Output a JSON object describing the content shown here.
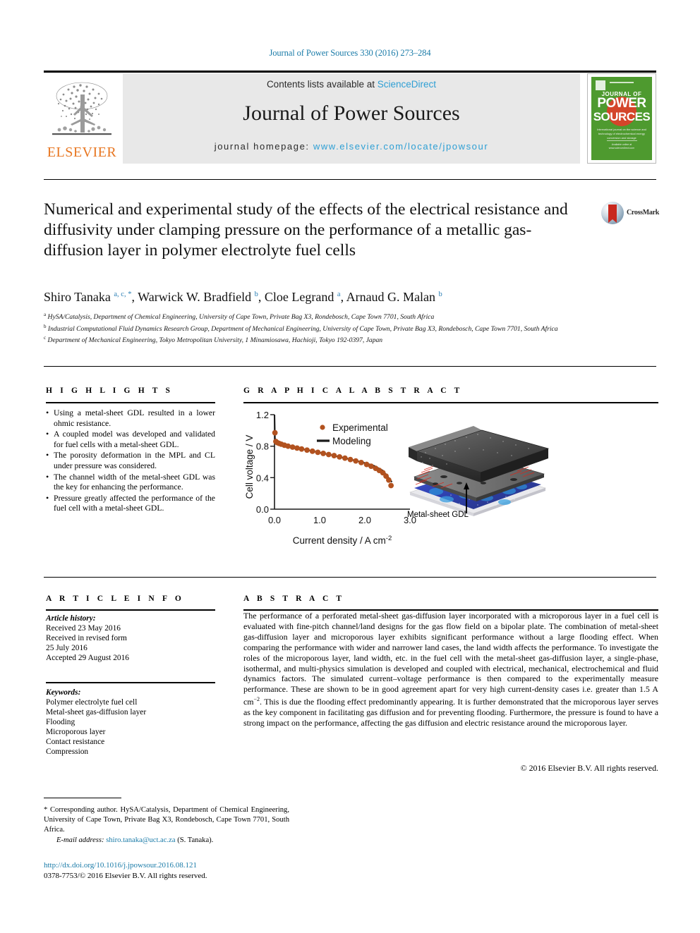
{
  "header": {
    "citation": "Journal of Power Sources 330 (2016) 273–284",
    "contents_prefix": "Contents lists available at ",
    "contents_link": "ScienceDirect",
    "journal_name": "Journal of Power Sources",
    "homepage_prefix": "journal homepage: ",
    "homepage_link": "www.elsevier.com/locate/jpowsour",
    "publisher": "ELSEVIER",
    "cover": {
      "line1": "JOURNAL OF",
      "line2": "POWER",
      "line3": "SOURCES",
      "subtitle": "International journal on the science and technology of electrochemical energy conversion and storage",
      "footer": "Available online at www.sciencedirect.com"
    }
  },
  "article": {
    "title": "Numerical and experimental study of the effects of the electrical resistance and diffusivity under clamping pressure on the performance of a metallic gas-diffusion layer in polymer electrolyte fuel cells",
    "crossmark_label": "CrossMark",
    "authors": [
      {
        "name": "Shiro Tanaka",
        "marks": "a, c, *"
      },
      {
        "name": "Warwick W. Bradfield",
        "marks": "b"
      },
      {
        "name": "Cloe Legrand",
        "marks": "a"
      },
      {
        "name": "Arnaud G. Malan",
        "marks": "b"
      }
    ],
    "affiliations": [
      {
        "mark": "a",
        "text": "HySA/Catalysis, Department of Chemical Engineering, University of Cape Town, Private Bag X3, Rondebosch, Cape Town 7701, South Africa"
      },
      {
        "mark": "b",
        "text": "Industrial Computational Fluid Dynamics Research Group, Department of Mechanical Engineering, University of Cape Town, Private Bag X3, Rondebosch, Cape Town 7701, South Africa"
      },
      {
        "mark": "c",
        "text": "Department of Mechanical Engineering, Tokyo Metropolitan University, 1 Minamiosawa, Hachioji, Tokyo 192-0397, Japan"
      }
    ]
  },
  "highlights": {
    "heading": "H I G H L I G H T S",
    "items": [
      "Using a metal-sheet GDL resulted in a lower ohmic resistance.",
      "A coupled model was developed and validated for fuel cells with a metal-sheet GDL.",
      "The porosity deformation in the MPL and CL under pressure was considered.",
      "The channel width of the metal-sheet GDL was the key for enhancing the performance.",
      "Pressure greatly affected the performance of the fuel cell with a metal-sheet GDL."
    ]
  },
  "graphical_abstract": {
    "heading": "G R A P H I C A L   A B S T R A C T",
    "figure_caption": "Metal-sheet GDL"
  },
  "chart_data": {
    "type": "scatter",
    "title": "",
    "xlabel": "Current density / A cm-2",
    "xlabel_base": "Current density / A cm",
    "xlabel_exp": "-2",
    "ylabel": "Cell voltage / V",
    "xlim": [
      0.0,
      3.0
    ],
    "ylim": [
      0.0,
      1.2
    ],
    "xticks": [
      "0.0",
      "1.0",
      "2.0",
      "3.0"
    ],
    "yticks": [
      "0.0",
      "0.4",
      "0.8",
      "1.2"
    ],
    "grid": false,
    "legend_position": "top-right",
    "marker_color": "#b2521f",
    "line_color": "#1a1a1a",
    "series": [
      {
        "name": "Experimental",
        "style": "markers",
        "x": [
          0.01,
          0.03,
          0.06,
          0.1,
          0.15,
          0.22,
          0.3,
          0.4,
          0.5,
          0.6,
          0.72,
          0.84,
          0.96,
          1.08,
          1.2,
          1.32,
          1.44,
          1.56,
          1.68,
          1.8,
          1.92,
          2.04,
          2.14,
          2.24,
          2.32,
          2.4,
          2.47,
          2.53,
          2.58
        ],
        "y": [
          0.97,
          0.86,
          0.845,
          0.835,
          0.825,
          0.812,
          0.8,
          0.788,
          0.776,
          0.764,
          0.75,
          0.736,
          0.722,
          0.708,
          0.694,
          0.68,
          0.664,
          0.648,
          0.63,
          0.612,
          0.592,
          0.568,
          0.545,
          0.518,
          0.492,
          0.462,
          0.42,
          0.37,
          0.3
        ]
      },
      {
        "name": "Modeling",
        "style": "line",
        "x": [
          0.0,
          0.01,
          0.04,
          0.1,
          0.2,
          0.4,
          0.6,
          0.8,
          1.0,
          1.2,
          1.4,
          1.6,
          1.8,
          2.0,
          2.2,
          2.4,
          2.6
        ],
        "y": [
          1.2,
          0.9,
          0.855,
          0.836,
          0.818,
          0.79,
          0.765,
          0.742,
          0.718,
          0.694,
          0.668,
          0.644,
          0.616,
          0.586,
          0.552,
          0.49,
          0.345
        ]
      }
    ]
  },
  "article_info": {
    "heading": "A R T I C L E   I N F O",
    "history_label": "Article history:",
    "history": [
      "Received 23 May 2016",
      "Received in revised form",
      "25 July 2016",
      "Accepted 29 August 2016"
    ],
    "keywords_label": "Keywords:",
    "keywords": [
      "Polymer electrolyte fuel cell",
      "Metal-sheet gas-diffusion layer",
      "Flooding",
      "Microporous layer",
      "Contact resistance",
      "Compression"
    ]
  },
  "abstract": {
    "heading": "A B S T R A C T",
    "part1": "The performance of a perforated metal-sheet gas-diffusion layer incorporated with a microporous layer in a fuel cell is evaluated with fine-pitch channel/land designs for the gas flow field on a bipolar plate. The combination of metal-sheet gas-diffusion layer and microporous layer exhibits significant performance without a large flooding effect. When comparing the performance with wider and narrower land cases, the land width affects the performance. To investigate the roles of the microporous layer, land width, etc. in the fuel cell with the metal-sheet gas-diffusion layer, a single-phase, isothermal, and multi-physics simulation is developed and coupled with electrical, mechanical, electrochemical and fluid dynamics factors. The simulated current–voltage performance is then compared to the experimentally measure performance. These are shown to be in good agreement apart for very high current-density cases i.e. greater than 1.5 A cm",
    "exponent": "−2",
    "part2": ". This is due the flooding effect predominantly appearing. It is further demonstrated that the microporous layer serves as the key component in facilitating gas diffusion and for preventing flooding. Furthermore, the pressure is found to have a strong impact on the performance, affecting the gas diffusion and electric resistance around the microporous layer.",
    "copyright": "© 2016 Elsevier B.V. All rights reserved."
  },
  "footer": {
    "corresponding": "* Corresponding author. HySA/Catalysis, Department of Chemical Engineering, University of Cape Town, Private Bag X3, Rondebosch, Cape Town 7701, South Africa.",
    "email_label": "E-mail address:",
    "email": "shiro.tanaka@uct.ac.za",
    "email_suffix": "(S. Tanaka).",
    "doi": "http://dx.doi.org/10.1016/j.jpowsour.2016.08.121",
    "issn": "0378-7753/© 2016 Elsevier B.V. All rights reserved."
  }
}
